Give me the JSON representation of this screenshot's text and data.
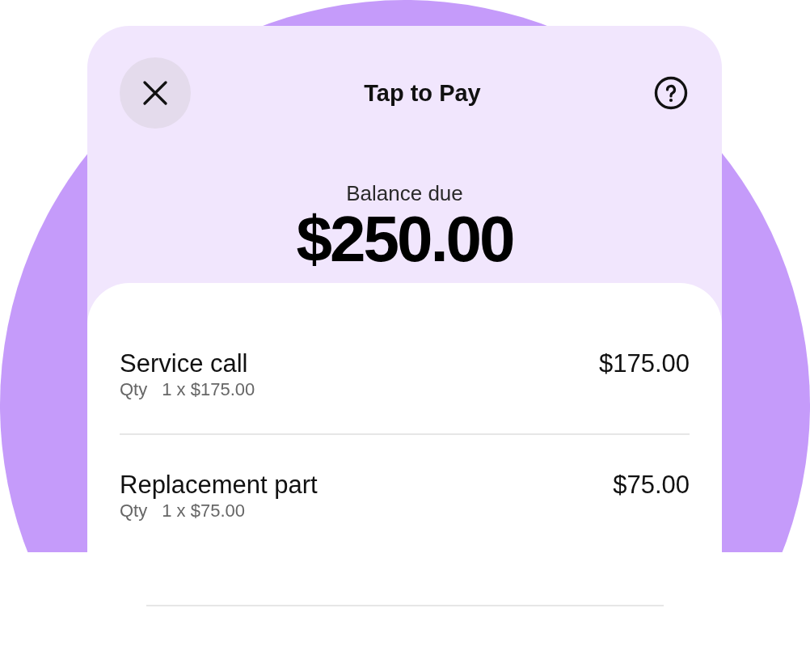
{
  "header": {
    "title": "Tap to Pay"
  },
  "balance": {
    "label": "Balance due",
    "amount": "$250.00"
  },
  "items": [
    {
      "name": "Service call",
      "qty_label": "Qty",
      "qty": "1 x $175.00",
      "amount": "$175.00"
    },
    {
      "name": "Replacement part",
      "qty_label": "Qty",
      "qty": "1 x $75.00",
      "amount": "$75.00"
    }
  ]
}
